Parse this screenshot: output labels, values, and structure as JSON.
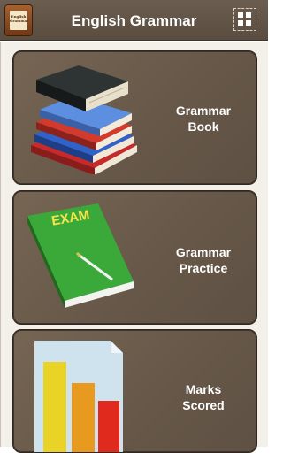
{
  "header": {
    "title": "English Grammar",
    "app_icon_text": "English Grammar"
  },
  "cards": [
    {
      "label_line1": "Grammar",
      "label_line2": "Book"
    },
    {
      "label_line1": "Grammar",
      "label_line2": "Practice"
    },
    {
      "label_line1": "Marks",
      "label_line2": "Scored"
    }
  ],
  "exam_book": {
    "cover_text": "EXAM"
  },
  "colors": {
    "appbar": "#5f5245",
    "card": "#6b5b4c",
    "exam_book": "#3aa93a",
    "bar_yellow": "#e8d326",
    "bar_orange": "#e89a20",
    "bar_red": "#e02a1e"
  }
}
